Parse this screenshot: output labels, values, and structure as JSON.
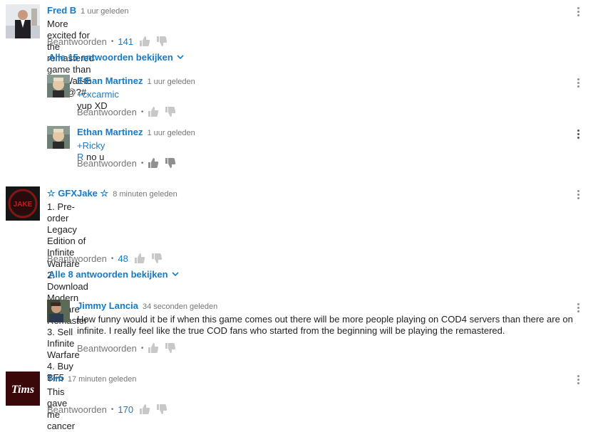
{
  "labels": {
    "reply": "Beantwoorden",
    "dot": "•"
  },
  "comments": [
    {
      "author": "Fred B",
      "time": "1 uur geleden",
      "text": "More excited for the remastered game than this Wall-E bull$@?#.",
      "likes": "141",
      "view_replies": "Alle 15 antwoorden bekijken"
    },
    {
      "author": "Ethan Martinez",
      "time": "1 uur geleden",
      "mention": "+cxcarmic",
      "text": " yup XD"
    },
    {
      "author": "Ethan Martinez",
      "time": "1 uur geleden",
      "mention": "+Ricky R",
      "text": " no u"
    },
    {
      "author": "☆ GFXJake ☆",
      "time": "8 minuten geleden",
      "lines": [
        "1. Pre-order Legacy Edition of Infinite Warfare",
        "2. Download Modern Warfare Remaster",
        "3. Sell Infinite Warfare",
        "4. Buy BF5"
      ],
      "likes": "48",
      "view_replies": "Alle 8 antwoorden bekijken",
      "avatar_text": "JAKE"
    },
    {
      "author": "Jimmy Lancia",
      "time": "34 seconden geleden",
      "text": "How funny would it be if when this game comes out there will be more people playing on COD4 servers than there are on infinite. I really feel like the true COD fans who started from the beginning will be playing the remastered."
    },
    {
      "author": "Tim",
      "time": "17 minuten geleden",
      "text": "This gave me cancer",
      "likes": "170",
      "avatar_text": "Tims"
    }
  ],
  "colors": {
    "link": "#167ac6",
    "muted": "#767676",
    "icon": "#909090"
  }
}
